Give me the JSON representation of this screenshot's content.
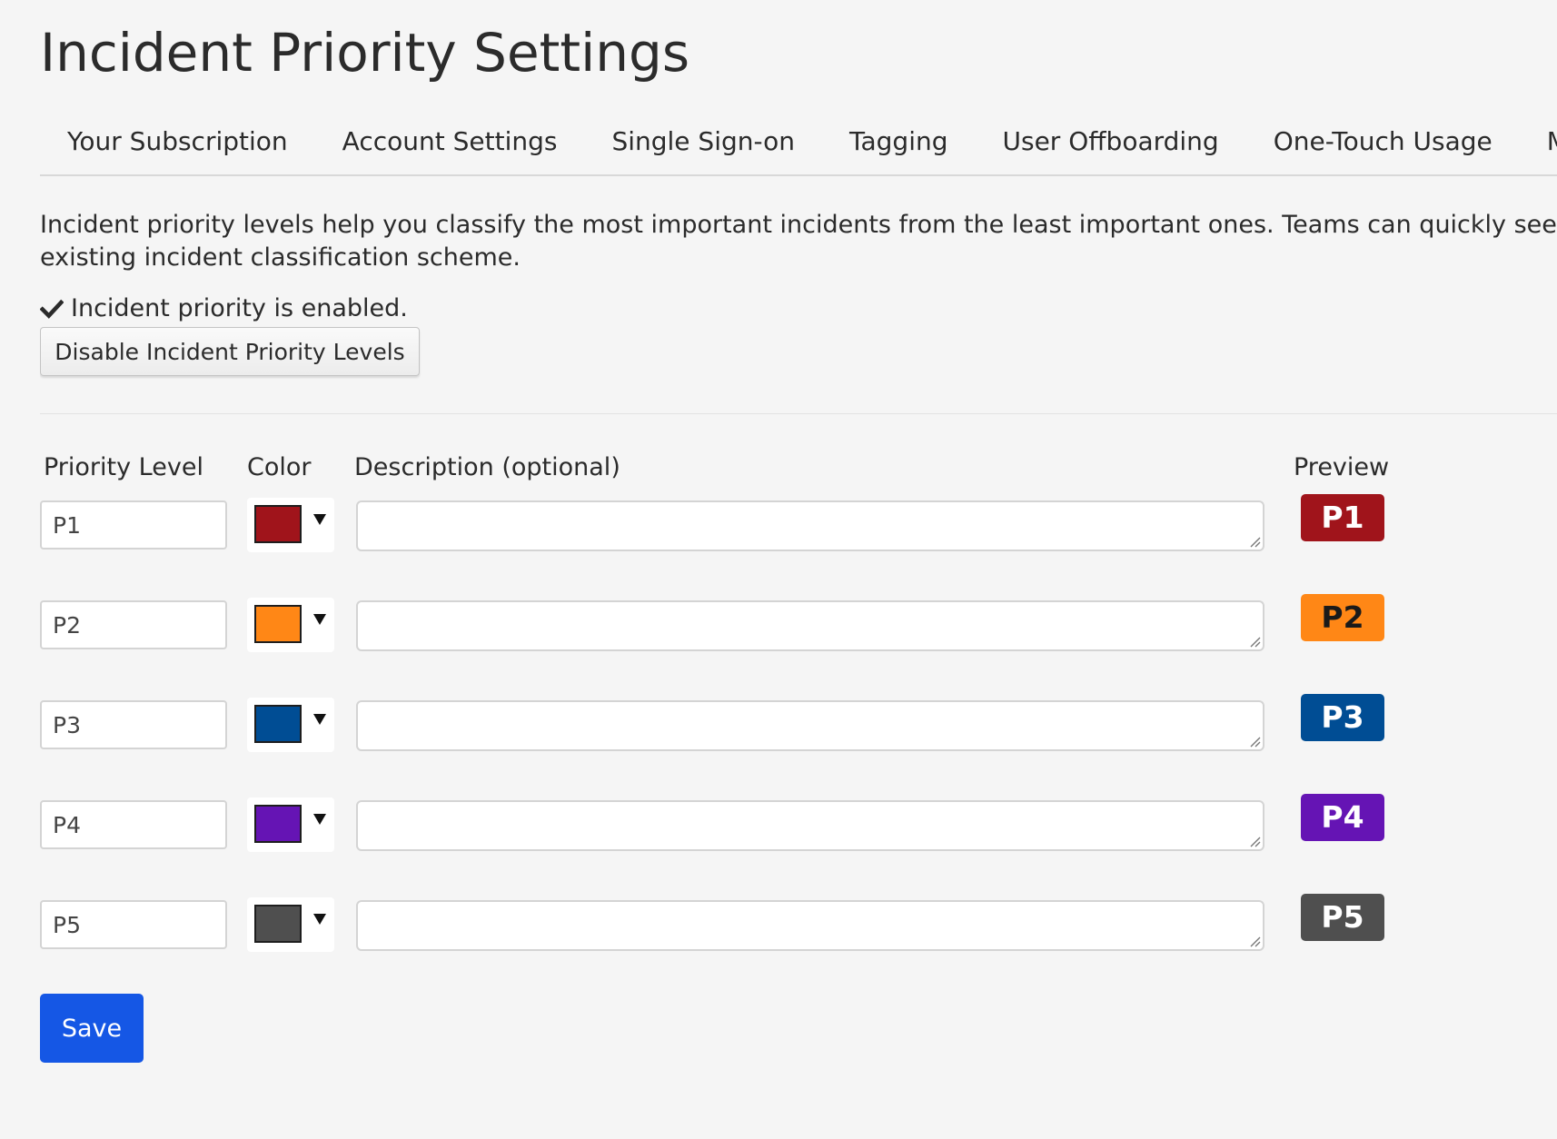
{
  "page_title": "Incident Priority Settings",
  "tabs": [
    {
      "label": "Your Subscription"
    },
    {
      "label": "Account Settings"
    },
    {
      "label": "Single Sign-on"
    },
    {
      "label": "Tagging"
    },
    {
      "label": "User Offboarding"
    },
    {
      "label": "One-Touch Usage"
    },
    {
      "label": "Mobile"
    }
  ],
  "intro": {
    "line1": "Incident priority levels help you classify the most important incidents from the least important ones. Teams can quickly see which i",
    "line2": "existing incident classification scheme."
  },
  "status": {
    "icon": "check-icon",
    "text": "Incident priority is enabled."
  },
  "disable_button_label": "Disable Incident Priority Levels",
  "columns": {
    "priority_level": "Priority Level",
    "color": "Color",
    "description": "Description (optional)",
    "preview": "Preview"
  },
  "priorities": [
    {
      "level": "P1",
      "color": "#a0141b",
      "text_color": "#ffffff",
      "description": "",
      "preview": "P1"
    },
    {
      "level": "P2",
      "color": "#ff8716",
      "text_color": "#1a1a1a",
      "description": "",
      "preview": "P2"
    },
    {
      "level": "P3",
      "color": "#004d94",
      "text_color": "#ffffff",
      "description": "",
      "preview": "P3"
    },
    {
      "level": "P4",
      "color": "#6514b4",
      "text_color": "#ffffff",
      "description": "",
      "preview": "P4"
    },
    {
      "level": "P5",
      "color": "#4f4f4f",
      "text_color": "#ffffff",
      "description": "",
      "preview": "P5"
    }
  ],
  "save_button_label": "Save",
  "colors": {
    "background": "#f5f5f5",
    "primary_button": "#1557e5"
  }
}
